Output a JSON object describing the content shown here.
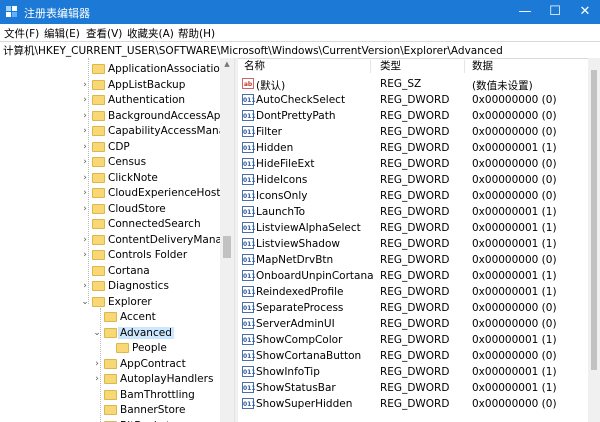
{
  "window": {
    "title": "注册表编辑器",
    "buttons": {
      "minimize": "—",
      "maximize": "☐",
      "close": "✕"
    }
  },
  "menu": [
    "文件(F)",
    "编辑(E)",
    "查看(V)",
    "收藏夹(A)",
    "帮助(H)"
  ],
  "address": "计算机\\HKEY_CURRENT_USER\\SOFTWARE\\Microsoft\\Windows\\CurrentVersion\\Explorer\\Advanced",
  "tree": [
    {
      "label": "ApplicationAssociationTo",
      "depth": 0,
      "expander": "none"
    },
    {
      "label": "AppListBackup",
      "depth": 0,
      "expander": "collapsed"
    },
    {
      "label": "Authentication",
      "depth": 0,
      "expander": "collapsed"
    },
    {
      "label": "BackgroundAccessApplic",
      "depth": 0,
      "expander": "collapsed"
    },
    {
      "label": "CapabilityAccessManager",
      "depth": 0,
      "expander": "collapsed"
    },
    {
      "label": "CDP",
      "depth": 0,
      "expander": "collapsed"
    },
    {
      "label": "Census",
      "depth": 0,
      "expander": "collapsed"
    },
    {
      "label": "ClickNote",
      "depth": 0,
      "expander": "collapsed"
    },
    {
      "label": "CloudExperienceHost",
      "depth": 0,
      "expander": "collapsed"
    },
    {
      "label": "CloudStore",
      "depth": 0,
      "expander": "collapsed"
    },
    {
      "label": "ConnectedSearch",
      "depth": 0,
      "expander": "none"
    },
    {
      "label": "ContentDeliveryManager",
      "depth": 0,
      "expander": "collapsed"
    },
    {
      "label": "Controls Folder",
      "depth": 0,
      "expander": "collapsed"
    },
    {
      "label": "Cortana",
      "depth": 0,
      "expander": "none"
    },
    {
      "label": "Diagnostics",
      "depth": 0,
      "expander": "collapsed"
    },
    {
      "label": "Explorer",
      "depth": 0,
      "expander": "expanded"
    },
    {
      "label": "Accent",
      "depth": 1,
      "expander": "none"
    },
    {
      "label": "Advanced",
      "depth": 1,
      "expander": "expanded",
      "selected": true
    },
    {
      "label": "People",
      "depth": 2,
      "expander": "none"
    },
    {
      "label": "AppContract",
      "depth": 1,
      "expander": "collapsed"
    },
    {
      "label": "AutoplayHandlers",
      "depth": 1,
      "expander": "collapsed"
    },
    {
      "label": "BamThrottling",
      "depth": 1,
      "expander": "none"
    },
    {
      "label": "BannerStore",
      "depth": 1,
      "expander": "none"
    },
    {
      "label": "BitBucket",
      "depth": 1,
      "expander": "collapsed"
    }
  ],
  "columns": {
    "name": "名称",
    "type": "类型",
    "data": "数据"
  },
  "values": [
    {
      "name": "(默认)",
      "type": "REG_SZ",
      "data": "(数值未设置)",
      "icon": "ab"
    },
    {
      "name": "AutoCheckSelect",
      "type": "REG_DWORD",
      "data": "0x00000000 (0)",
      "icon": "bin"
    },
    {
      "name": "DontPrettyPath",
      "type": "REG_DWORD",
      "data": "0x00000000 (0)",
      "icon": "bin"
    },
    {
      "name": "Filter",
      "type": "REG_DWORD",
      "data": "0x00000000 (0)",
      "icon": "bin"
    },
    {
      "name": "Hidden",
      "type": "REG_DWORD",
      "data": "0x00000001 (1)",
      "icon": "bin"
    },
    {
      "name": "HideFileExt",
      "type": "REG_DWORD",
      "data": "0x00000000 (0)",
      "icon": "bin"
    },
    {
      "name": "HideIcons",
      "type": "REG_DWORD",
      "data": "0x00000000 (0)",
      "icon": "bin"
    },
    {
      "name": "IconsOnly",
      "type": "REG_DWORD",
      "data": "0x00000000 (0)",
      "icon": "bin"
    },
    {
      "name": "LaunchTo",
      "type": "REG_DWORD",
      "data": "0x00000001 (1)",
      "icon": "bin"
    },
    {
      "name": "ListviewAlphaSelect",
      "type": "REG_DWORD",
      "data": "0x00000001 (1)",
      "icon": "bin"
    },
    {
      "name": "ListviewShadow",
      "type": "REG_DWORD",
      "data": "0x00000001 (1)",
      "icon": "bin"
    },
    {
      "name": "MapNetDrvBtn",
      "type": "REG_DWORD",
      "data": "0x00000000 (0)",
      "icon": "bin"
    },
    {
      "name": "OnboardUnpinCortana",
      "type": "REG_DWORD",
      "data": "0x00000001 (1)",
      "icon": "bin"
    },
    {
      "name": "ReindexedProfile",
      "type": "REG_DWORD",
      "data": "0x00000001 (1)",
      "icon": "bin"
    },
    {
      "name": "SeparateProcess",
      "type": "REG_DWORD",
      "data": "0x00000000 (0)",
      "icon": "bin"
    },
    {
      "name": "ServerAdminUI",
      "type": "REG_DWORD",
      "data": "0x00000000 (0)",
      "icon": "bin"
    },
    {
      "name": "ShowCompColor",
      "type": "REG_DWORD",
      "data": "0x00000001 (1)",
      "icon": "bin"
    },
    {
      "name": "ShowCortanaButton",
      "type": "REG_DWORD",
      "data": "0x00000000 (0)",
      "icon": "bin"
    },
    {
      "name": "ShowInfoTip",
      "type": "REG_DWORD",
      "data": "0x00000001 (1)",
      "icon": "bin"
    },
    {
      "name": "ShowStatusBar",
      "type": "REG_DWORD",
      "data": "0x00000001 (1)",
      "icon": "bin"
    },
    {
      "name": "ShowSuperHidden",
      "type": "REG_DWORD",
      "data": "0x00000000 (0)",
      "icon": "bin"
    }
  ],
  "colors": {
    "titlebar": "#1c7ad6",
    "selection": "#cce8ff",
    "folder": "#f8d775"
  }
}
